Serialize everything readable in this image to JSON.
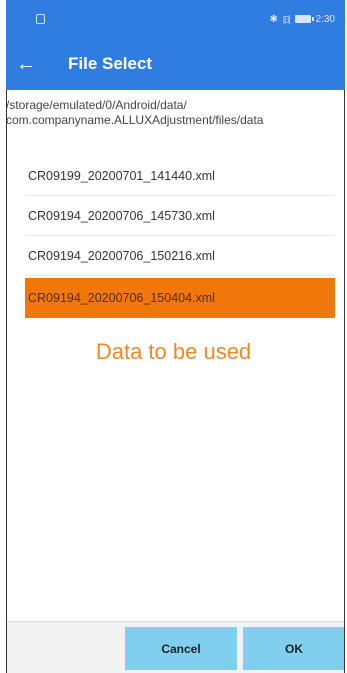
{
  "status_bar": {
    "time": "2:30",
    "bluetooth_icon": "bluetooth-icon",
    "vibrate_icon": "vibrate-icon",
    "battery_icon": "battery-icon",
    "bluetooth_glyph": "✱",
    "vibrate_glyph": "|▯|"
  },
  "app_bar": {
    "title": "File Select",
    "back_glyph": "←",
    "color": "#2f7de1"
  },
  "path": {
    "line1": "/storage/emulated/0/Android/data/",
    "line2": "com.companyname.ALLUXAdjustment/files/data"
  },
  "files": [
    {
      "name": "CR09199_20200701_141440.xml",
      "selected": false
    },
    {
      "name": "CR09194_20200706_145730.xml",
      "selected": false
    },
    {
      "name": "CR09194_20200706_150216.xml",
      "selected": false
    },
    {
      "name": "CR09194_20200706_150404.xml",
      "selected": true
    }
  ],
  "selection_color": "#f0780a",
  "annotation": "Data to be used",
  "buttons": {
    "cancel_label": "Cancel",
    "ok_label": "OK",
    "button_color": "#81cfef"
  }
}
